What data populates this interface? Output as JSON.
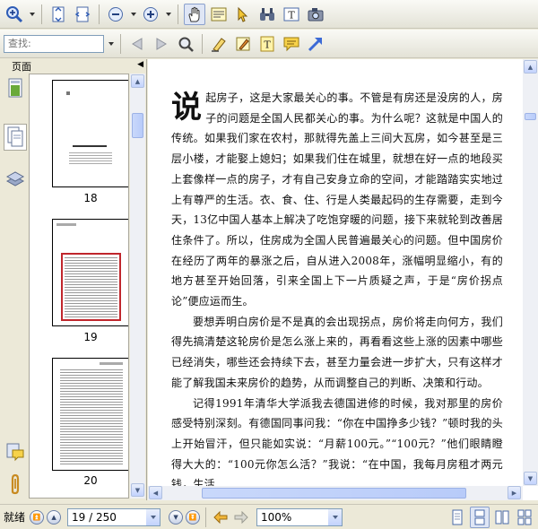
{
  "toolbar": {
    "search_placeholder": "查找:"
  },
  "left_panel": {
    "title": "页面",
    "thumbnails": [
      {
        "label": "18"
      },
      {
        "label": "19"
      },
      {
        "label": "20"
      }
    ]
  },
  "document": {
    "dropcap": "说",
    "paragraphs": [
      "起房子，这是大家最关心的事。不管是有房还是没房的人，房子的问题是全国人民都关心的事。为什么呢？这就是中国人的传统。如果我们家在农村，那就得先盖上三间大瓦房，如今甚至是三层小楼，才能娶上媳妇；如果我们住在城里，就想在好一点的地段买上套像样一点的房子，才有自己安身立命的空间，才能踏踏实实地过上有尊严的生活。衣、食、住、行是人类最起码的生存需要，走到今天，13亿中国人基本上解决了吃饱穿暖的问题，接下来就轮到改善居住条件了。所以，住房成为全国人民普遍最关心的问题。但中国房价在经历了两年的暴涨之后，自从进入2008年，涨幅明显缩小，有的地方甚至开始回落，引来全国上下一片质疑之声，于是“房价拐点论”便应运而生。",
      "要想弄明白房价是不是真的会出现拐点，房价将走向何方，我们得先搞清楚这轮房价是怎么涨上来的，再看看这些上涨的因素中哪些已经消失，哪些还会持续下去，甚至力量会进一步扩大，只有这样才能了解我国未来房价的趋势，从而调整自己的判断、决策和行动。",
      "记得1991年清华大学派我去德国进修的时候，我对那里的房价感受特别深刻。有德国同事问我：“你在中国挣多少钱？”顿时我的头上开始冒汗，但只能如实说：“月薪100元。”“100元？”他们眼睛瞪得大大的：“100元你怎么活？”我说：“在中国，我每月房租才两元钱，生活"
    ]
  },
  "status": {
    "ready_text": "就绪",
    "page_indicator": "19 / 250",
    "zoom": "100%"
  },
  "colors": {
    "selection_red": "#c0262c",
    "highlight_blue": "#3c6ad6",
    "scroll_blue": "#c3d3fd"
  }
}
